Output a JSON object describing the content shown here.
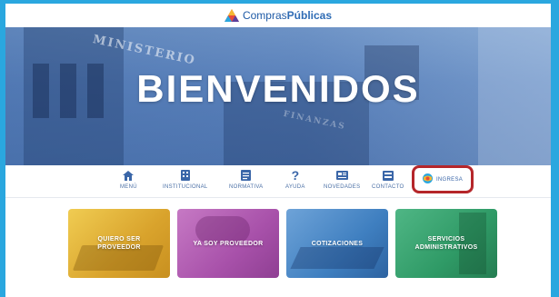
{
  "brand": {
    "name_part1": "Compras",
    "name_part2": "Públicas"
  },
  "hero": {
    "title": "BIENVENIDOS",
    "sign_text_1": "MINISTERIO",
    "sign_text_2": "FINANZAS"
  },
  "nav": {
    "items": [
      {
        "label": "MENÚ",
        "icon": "home-icon"
      },
      {
        "label": "INSTITUCIONAL",
        "icon": "building-icon"
      },
      {
        "label": "NORMATIVA",
        "icon": "document-icon"
      },
      {
        "label": "AYUDA",
        "icon": "question-icon"
      },
      {
        "label": "NOVEDADES",
        "icon": "news-icon"
      },
      {
        "label": "CONTACTO",
        "icon": "contact-icon"
      }
    ],
    "login_label": "INGRESA"
  },
  "cards": [
    {
      "label": "QUIERO SER\nPROVEEDOR",
      "color": "#e3b43a"
    },
    {
      "label": "YA SOY PROVEEDOR",
      "color": "#b25fb0"
    },
    {
      "label": "COTIZACIONES",
      "color": "#3b7fc1"
    },
    {
      "label": "SERVICIOS\nADMINISTRATIVOS",
      "color": "#2e9a66"
    }
  ],
  "colors": {
    "accent": "#2aa7df",
    "highlight": "#b5262a",
    "brand_blue": "#1e5aa6"
  }
}
